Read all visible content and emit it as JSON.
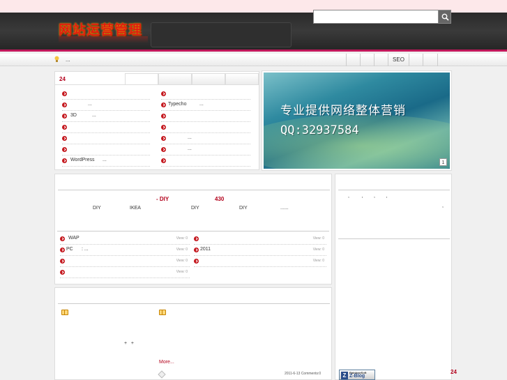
{
  "site": {
    "logo_text": "网站运营管理"
  },
  "search": {
    "placeholder": ""
  },
  "nav": {
    "notice": "...",
    "items": [
      "",
      "",
      "",
      "SEO",
      "",
      ""
    ]
  },
  "tabs_panel": {
    "count": "24",
    "left_list": [
      {
        "text": "",
        "dots": ""
      },
      {
        "text": "",
        "dots": "..."
      },
      {
        "text": "3D",
        "dots": "..."
      },
      {
        "text": "",
        "dots": ""
      },
      {
        "text": "",
        "dots": ""
      },
      {
        "text": "",
        "dots": ""
      },
      {
        "text": "WordPress",
        "dots": "..."
      }
    ],
    "right_list": [
      {
        "text": "",
        "dots": ""
      },
      {
        "text": "Typecho",
        "dots": "..."
      },
      {
        "text": "",
        "dots": ""
      },
      {
        "text": "",
        "dots": ""
      },
      {
        "text": "",
        "dots": "..."
      },
      {
        "text": "",
        "dots": "..."
      },
      {
        "text": "",
        "dots": ""
      }
    ]
  },
  "banner": {
    "line1": "专业提供网络整体营销",
    "line2": "QQ:32937584",
    "page": "1"
  },
  "featured": {
    "title_a": "- DIY",
    "title_b": "430",
    "words": [
      "DIY",
      "IKEA",
      "DIY",
      "DIY",
      "......"
    ]
  },
  "article_list": {
    "left": [
      {
        "text": "WAP",
        "dots": "",
        "view": "View: 0"
      },
      {
        "text": "PC",
        "dots": ":      ...",
        "view": "View: 0"
      },
      {
        "text": "",
        "dots": "",
        "view": "View: 0"
      },
      {
        "text": "",
        "dots": "",
        "view": "View: 0"
      }
    ],
    "right": [
      {
        "text": "",
        "dots": "",
        "view": "View: 0"
      },
      {
        "text": "2011",
        "dots": "",
        "view": "View: 0"
      },
      {
        "text": "",
        "dots": "",
        "view": "View: 0"
      }
    ]
  },
  "sidebar": {
    "line": ",         ,        ,        ,",
    "comma": ","
  },
  "post": {
    "plus": "+   +",
    "more": "More...",
    "meta": "2011-6-13 Comments:0"
  },
  "badge": {
    "top": "RainbowSoft",
    "main": "Z-Blog",
    "z": "Z"
  },
  "footer": {
    "count": "24"
  }
}
